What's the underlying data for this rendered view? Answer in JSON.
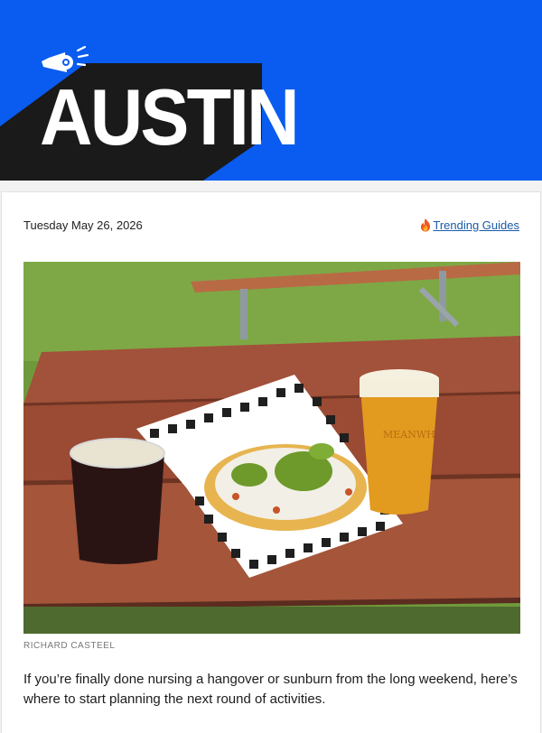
{
  "header": {
    "brand_name": "AUSTIN",
    "logo_icon": "megaphone-icon",
    "colors": {
      "brand_blue": "#0a5cf0",
      "shadow_black": "#1a1a1a",
      "text_white": "#ffffff"
    }
  },
  "card": {
    "date": "Tuesday May 26, 2026",
    "trending": {
      "icon": "fire-icon",
      "label": "Trending Guides",
      "link_color": "#1a5aa9"
    },
    "hero_image": {
      "description_icon": "nachos-and-beers-photo"
    },
    "photo_credit": "RICHARD CASTEEL",
    "lede": "If you’re finally done nursing a hangover or sunburn from the long weekend, here’s where to start planning the next round of activities.",
    "glass_print": "MEANWH"
  }
}
